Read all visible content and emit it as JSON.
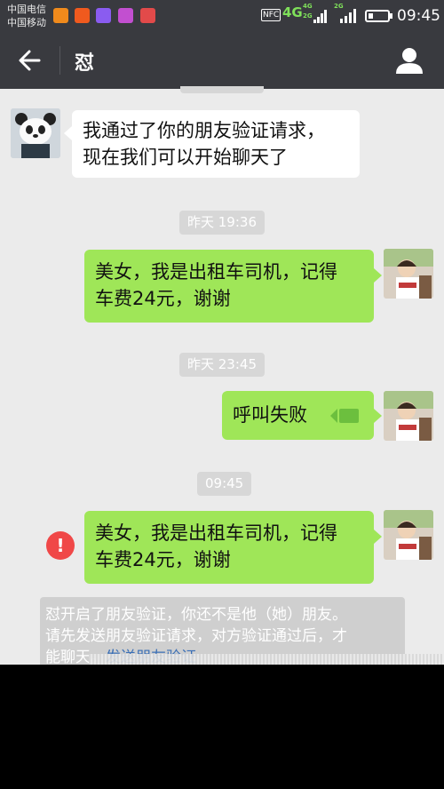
{
  "status_bar": {
    "carrier_1": "中国电信",
    "carrier_2": "中国移动",
    "nfc": "NFC",
    "network": "4G",
    "mini_1": "4G",
    "mini_2": "2G",
    "mini_3": "2G",
    "time": "09:45",
    "battery_level": 0.25,
    "notification_icons": [
      "taobao-icon",
      "taobao-icon",
      "game-icon",
      "app-icon",
      "game-icon"
    ]
  },
  "header": {
    "title": "怼",
    "back_icon": "arrow-left-icon",
    "profile_icon": "person-icon"
  },
  "messages": {
    "m1": {
      "line1": "我通过了你的朋友验证请求，",
      "line2": "现在我们可以开始聊天了"
    },
    "ts1": "昨天 19:36",
    "m2": {
      "line1": "美女，我是出租车司机，记得",
      "line2": "车费24元，谢谢"
    },
    "ts2": "昨天 23:45",
    "m3": {
      "text": "呼叫失败"
    },
    "ts3": "09:45",
    "m4": {
      "line1": "美女，我是出租车司机，记得",
      "line2": "车费24元，谢谢"
    }
  },
  "error_icon": "!",
  "system_notice": {
    "line1": "怼开启了朋友验证，你还不是他（她）朋友。",
    "line2": "请先发送朋友验证请求，对方验证通过后，才",
    "line3_prefix": "能聊天。",
    "link": "发送朋友验证"
  },
  "colors": {
    "bar": "#393a3f",
    "chat_bg": "#ebebeb",
    "outgoing_bubble": "#9fe658",
    "incoming_bubble": "#ffffff",
    "error": "#f04848"
  }
}
